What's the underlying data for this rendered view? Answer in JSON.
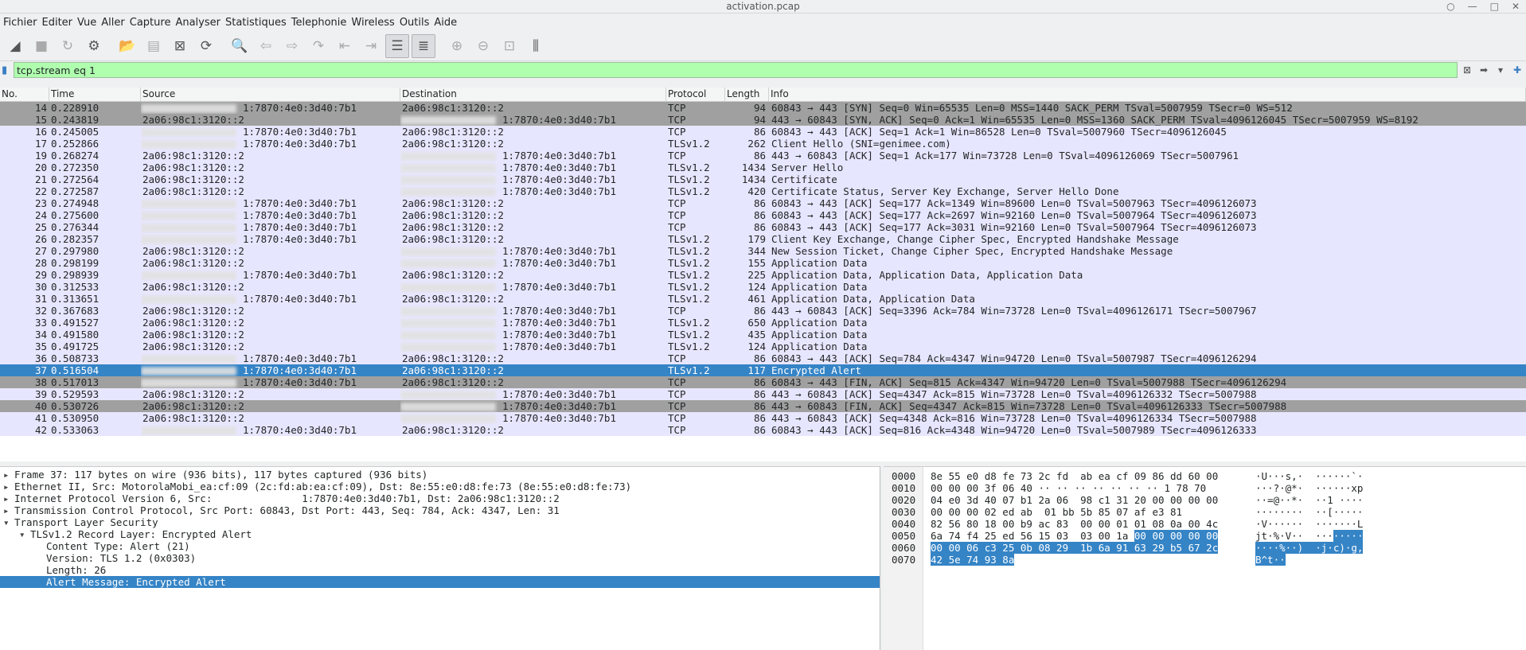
{
  "window": {
    "title": "activation.pcap"
  },
  "menu": [
    "Fichier",
    "Editer",
    "Vue",
    "Aller",
    "Capture",
    "Analyser",
    "Statistiques",
    "Telephonie",
    "Wireless",
    "Outils",
    "Aide"
  ],
  "filter": {
    "value": "tcp.stream eq 1"
  },
  "columns": [
    "No.",
    "Time",
    "Source",
    "Destination",
    "Protocol",
    "Length",
    "Info"
  ],
  "packets": [
    {
      "no": "14",
      "time": "0.228910",
      "src": "1:7870:4e0:3d40:7b1",
      "src_redacted": true,
      "src_side": "right",
      "dst": "2a06:98c1:3120::2",
      "dst_side": "left",
      "proto": "TCP",
      "len": "94",
      "info": "60843 → 443 [SYN] Seq=0 Win=65535 Len=0 MSS=1440 SACK_PERM TSval=5007959 TSecr=0 WS=512",
      "style": "gray"
    },
    {
      "no": "15",
      "time": "0.243819",
      "src": "2a06:98c1:3120::2",
      "src_side": "left",
      "dst": "1:7870:4e0:3d40:7b1",
      "dst_side": "right",
      "proto": "TCP",
      "len": "94",
      "info": "443 → 60843 [SYN, ACK] Seq=0 Ack=1 Win=65535 Len=0 MSS=1360 SACK_PERM TSval=4096126045 TSecr=5007959 WS=8192",
      "style": "gray"
    },
    {
      "no": "16",
      "time": "0.245005",
      "src": "1:7870:4e0:3d40:7b1",
      "src_side": "right",
      "dst": "2a06:98c1:3120::2",
      "dst_side": "left",
      "proto": "TCP",
      "len": "86",
      "info": "60843 → 443 [ACK] Seq=1 Ack=1 Win=86528 Len=0 TSval=5007960 TSecr=4096126045",
      "style": "tcp"
    },
    {
      "no": "17",
      "time": "0.252866",
      "src": "1:7870:4e0:3d40:7b1",
      "src_side": "right",
      "dst": "2a06:98c1:3120::2",
      "dst_side": "left",
      "proto": "TLSv1.2",
      "len": "262",
      "info": "Client Hello (SNI=genimee.com)",
      "style": "tcp"
    },
    {
      "no": "19",
      "time": "0.268274",
      "src": "2a06:98c1:3120::2",
      "src_side": "left",
      "dst": "1:7870:4e0:3d40:7b1",
      "dst_side": "right",
      "proto": "TCP",
      "len": "86",
      "info": "443 → 60843 [ACK] Seq=1 Ack=177 Win=73728 Len=0 TSval=4096126069 TSecr=5007961",
      "style": "tcp"
    },
    {
      "no": "20",
      "time": "0.272350",
      "src": "2a06:98c1:3120::2",
      "src_side": "left",
      "dst": "1:7870:4e0:3d40:7b1",
      "dst_side": "right",
      "proto": "TLSv1.2",
      "len": "1434",
      "info": "Server Hello",
      "style": "tcp"
    },
    {
      "no": "21",
      "time": "0.272564",
      "src": "2a06:98c1:3120::2",
      "src_side": "left",
      "dst": "1:7870:4e0:3d40:7b1",
      "dst_side": "right",
      "proto": "TLSv1.2",
      "len": "1434",
      "info": "Certificate",
      "style": "tcp"
    },
    {
      "no": "22",
      "time": "0.272587",
      "src": "2a06:98c1:3120::2",
      "src_side": "left",
      "dst": "1:7870:4e0:3d40:7b1",
      "dst_side": "right",
      "proto": "TLSv1.2",
      "len": "420",
      "info": "Certificate Status, Server Key Exchange, Server Hello Done",
      "style": "tcp"
    },
    {
      "no": "23",
      "time": "0.274948",
      "src": "1:7870:4e0:3d40:7b1",
      "src_side": "right",
      "dst": "2a06:98c1:3120::2",
      "dst_side": "left",
      "proto": "TCP",
      "len": "86",
      "info": "60843 → 443 [ACK] Seq=177 Ack=1349 Win=89600 Len=0 TSval=5007963 TSecr=4096126073",
      "style": "tcp"
    },
    {
      "no": "24",
      "time": "0.275600",
      "src": "1:7870:4e0:3d40:7b1",
      "src_side": "right",
      "dst": "2a06:98c1:3120::2",
      "dst_side": "left",
      "proto": "TCP",
      "len": "86",
      "info": "60843 → 443 [ACK] Seq=177 Ack=2697 Win=92160 Len=0 TSval=5007964 TSecr=4096126073",
      "style": "tcp"
    },
    {
      "no": "25",
      "time": "0.276344",
      "src": "1:7870:4e0:3d40:7b1",
      "src_side": "right",
      "dst": "2a06:98c1:3120::2",
      "dst_side": "left",
      "proto": "TCP",
      "len": "86",
      "info": "60843 → 443 [ACK] Seq=177 Ack=3031 Win=92160 Len=0 TSval=5007964 TSecr=4096126073",
      "style": "tcp"
    },
    {
      "no": "26",
      "time": "0.282357",
      "src": "1:7870:4e0:3d40:7b1",
      "src_side": "right",
      "dst": "2a06:98c1:3120::2",
      "dst_side": "left",
      "proto": "TLSv1.2",
      "len": "179",
      "info": "Client Key Exchange, Change Cipher Spec, Encrypted Handshake Message",
      "style": "tcp"
    },
    {
      "no": "27",
      "time": "0.297980",
      "src": "2a06:98c1:3120::2",
      "src_side": "left",
      "dst": "1:7870:4e0:3d40:7b1",
      "dst_side": "right",
      "proto": "TLSv1.2",
      "len": "344",
      "info": "New Session Ticket, Change Cipher Spec, Encrypted Handshake Message",
      "style": "tcp"
    },
    {
      "no": "28",
      "time": "0.298199",
      "src": "2a06:98c1:3120::2",
      "src_side": "left",
      "dst": "1:7870:4e0:3d40:7b1",
      "dst_side": "right",
      "proto": "TLSv1.2",
      "len": "155",
      "info": "Application Data",
      "style": "tcp"
    },
    {
      "no": "29",
      "time": "0.298939",
      "src": "1:7870:4e0:3d40:7b1",
      "src_side": "right",
      "dst": "2a06:98c1:3120::2",
      "dst_side": "left",
      "proto": "TLSv1.2",
      "len": "225",
      "info": "Application Data, Application Data, Application Data",
      "style": "tcp"
    },
    {
      "no": "30",
      "time": "0.312533",
      "src": "2a06:98c1:3120::2",
      "src_side": "left",
      "dst": "1:7870:4e0:3d40:7b1",
      "dst_side": "right",
      "proto": "TLSv1.2",
      "len": "124",
      "info": "Application Data",
      "style": "tcp"
    },
    {
      "no": "31",
      "time": "0.313651",
      "src": "1:7870:4e0:3d40:7b1",
      "src_side": "right",
      "dst": "2a06:98c1:3120::2",
      "dst_side": "left",
      "proto": "TLSv1.2",
      "len": "461",
      "info": "Application Data, Application Data",
      "style": "tcp"
    },
    {
      "no": "32",
      "time": "0.367683",
      "src": "2a06:98c1:3120::2",
      "src_side": "left",
      "dst": "1:7870:4e0:3d40:7b1",
      "dst_side": "right",
      "proto": "TCP",
      "len": "86",
      "info": "443 → 60843 [ACK] Seq=3396 Ack=784 Win=73728 Len=0 TSval=4096126171 TSecr=5007967",
      "style": "tcp"
    },
    {
      "no": "33",
      "time": "0.491527",
      "src": "2a06:98c1:3120::2",
      "src_side": "left",
      "dst": "1:7870:4e0:3d40:7b1",
      "dst_side": "right",
      "proto": "TLSv1.2",
      "len": "650",
      "info": "Application Data",
      "style": "tcp"
    },
    {
      "no": "34",
      "time": "0.491580",
      "src": "2a06:98c1:3120::2",
      "src_side": "left",
      "dst": "1:7870:4e0:3d40:7b1",
      "dst_side": "right",
      "proto": "TLSv1.2",
      "len": "435",
      "info": "Application Data",
      "style": "tcp"
    },
    {
      "no": "35",
      "time": "0.491725",
      "src": "2a06:98c1:3120::2",
      "src_side": "left",
      "dst": "1:7870:4e0:3d40:7b1",
      "dst_side": "right",
      "proto": "TLSv1.2",
      "len": "124",
      "info": "Application Data",
      "style": "tcp"
    },
    {
      "no": "36",
      "time": "0.508733",
      "src": "1:7870:4e0:3d40:7b1",
      "src_side": "right",
      "dst": "2a06:98c1:3120::2",
      "dst_side": "left",
      "proto": "TCP",
      "len": "86",
      "info": "60843 → 443 [ACK] Seq=784 Ack=4347 Win=94720 Len=0 TSval=5007987 TSecr=4096126294",
      "style": "tcp"
    },
    {
      "no": "37",
      "time": "0.516504",
      "src": "1:7870:4e0:3d40:7b1",
      "src_side": "right",
      "dst": "2a06:98c1:3120::2",
      "dst_side": "left",
      "proto": "TLSv1.2",
      "len": "117",
      "info": "Encrypted Alert",
      "style": "sel"
    },
    {
      "no": "38",
      "time": "0.517013",
      "src": "1:7870:4e0:3d40:7b1",
      "src_side": "right",
      "dst": "2a06:98c1:3120::2",
      "dst_side": "left",
      "proto": "TCP",
      "len": "86",
      "info": "60843 → 443 [FIN, ACK] Seq=815 Ack=4347 Win=94720 Len=0 TSval=5007988 TSecr=4096126294",
      "style": "gray"
    },
    {
      "no": "39",
      "time": "0.529593",
      "src": "2a06:98c1:3120::2",
      "src_side": "left",
      "dst": "1:7870:4e0:3d40:7b1",
      "dst_side": "right",
      "proto": "TCP",
      "len": "86",
      "info": "443 → 60843 [ACK] Seq=4347 Ack=815 Win=73728 Len=0 TSval=4096126332 TSecr=5007988",
      "style": "tcp"
    },
    {
      "no": "40",
      "time": "0.530726",
      "src": "2a06:98c1:3120::2",
      "src_side": "left",
      "dst": "1:7870:4e0:3d40:7b1",
      "dst_side": "right",
      "proto": "TCP",
      "len": "86",
      "info": "443 → 60843 [FIN, ACK] Seq=4347 Ack=815 Win=73728 Len=0 TSval=4096126333 TSecr=5007988",
      "style": "gray"
    },
    {
      "no": "41",
      "time": "0.530950",
      "src": "2a06:98c1:3120::2",
      "src_side": "left",
      "dst": "1:7870:4e0:3d40:7b1",
      "dst_side": "right",
      "proto": "TCP",
      "len": "86",
      "info": "443 → 60843 [ACK] Seq=4348 Ack=816 Win=73728 Len=0 TSval=4096126334 TSecr=5007988",
      "style": "tcp"
    },
    {
      "no": "42",
      "time": "0.533063",
      "src": "1:7870:4e0:3d40:7b1",
      "src_side": "right",
      "dst": "2a06:98c1:3120::2",
      "dst_side": "left",
      "proto": "TCP",
      "len": "86",
      "info": "60843 → 443 [ACK] Seq=816 Ack=4348 Win=94720 Len=0 TSval=5007989 TSecr=4096126333",
      "style": "tcp"
    }
  ],
  "details": [
    {
      "indent": 0,
      "arrow": "▸",
      "text": "Frame 37: 117 bytes on wire (936 bits), 117 bytes captured (936 bits)"
    },
    {
      "indent": 0,
      "arrow": "▸",
      "text": "Ethernet II, Src: MotorolaMobi_ea:cf:09 (2c:fd:ab:ea:cf:09), Dst: 8e:55:e0:d8:fe:73 (8e:55:e0:d8:fe:73)"
    },
    {
      "indent": 0,
      "arrow": "▸",
      "text": "Internet Protocol Version 6, Src:               1:7870:4e0:3d40:7b1, Dst: 2a06:98c1:3120::2"
    },
    {
      "indent": 0,
      "arrow": "▸",
      "text": "Transmission Control Protocol, Src Port: 60843, Dst Port: 443, Seq: 784, Ack: 4347, Len: 31"
    },
    {
      "indent": 0,
      "arrow": "▾",
      "text": "Transport Layer Security"
    },
    {
      "indent": 1,
      "arrow": "▾",
      "text": "TLSv1.2 Record Layer: Encrypted Alert"
    },
    {
      "indent": 2,
      "arrow": "",
      "text": "Content Type: Alert (21)"
    },
    {
      "indent": 2,
      "arrow": "",
      "text": "Version: TLS 1.2 (0x0303)"
    },
    {
      "indent": 2,
      "arrow": "",
      "text": "Length: 26"
    },
    {
      "indent": 2,
      "arrow": "",
      "text": "Alert Message: Encrypted Alert",
      "selected": true
    }
  ],
  "bytes": [
    {
      "off": "0000",
      "hex": "8e 55 e0 d8 fe 73 2c fd  ab ea cf 09 86 dd 60 00",
      "ascii": "·U···s,·  ······`·",
      "hl_from": -1
    },
    {
      "off": "0010",
      "hex": "00 00 00 3f 06 40 ·· ·· ·· ·· ·· ·· ·· 1 78 70",
      "ascii": "···?·@*·  ······xp",
      "hl_from": -1
    },
    {
      "off": "0020",
      "hex": "04 e0 3d 40 07 b1 2a 06  98 c1 31 20 00 00 00 00",
      "ascii": "··=@··*·  ··1 ····",
      "hl_from": -1
    },
    {
      "off": "0030",
      "hex": "00 00 00 02 ed ab  01 bb 5b 85 07 af e3 81",
      "ascii": "········  ··[·····",
      "hl_from": -1
    },
    {
      "off": "0040",
      "hex": "82 56 80 18 00 b9 ac 83  00 00 01 01 08 0a 00 4c",
      "ascii": "·V······  ·······L",
      "hl_from": -1
    },
    {
      "off": "0050",
      "hex_a": "6a 74 f4 25 ed 56 15 03  03 00 1a ",
      "hex_b": "00 00 00 00 00",
      "ascii_a": "jt·%·V··  ···",
      "ascii_b": "·····"
    },
    {
      "off": "0060",
      "hex_b": "00 00 06 c3 25 0b 08 29  1b 6a 91 63 29 b5 67 2c",
      "ascii_b": "····%··)  ·j·c)·g,"
    },
    {
      "off": "0070",
      "hex_b": "42 5e 74 93 8a",
      "ascii_b": "B^t··"
    }
  ]
}
